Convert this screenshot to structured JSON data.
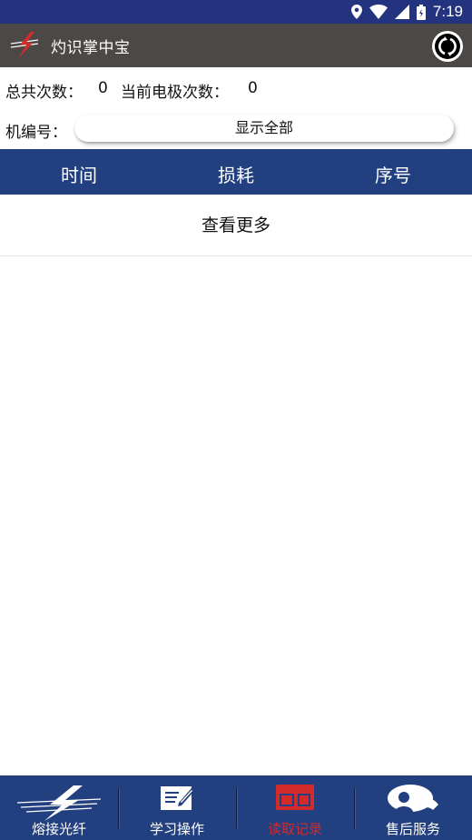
{
  "status_bar": {
    "time": "7:19",
    "icons": [
      "location-icon",
      "wifi-icon",
      "signal-icon",
      "battery-icon"
    ]
  },
  "app_bar": {
    "title": "灼识掌中宝",
    "logo": "lightning-logo",
    "action": "refresh-icon"
  },
  "stats": {
    "total_label": "总共次数：",
    "total_value": "0",
    "current_label": "当前电极次数：",
    "current_value": "0"
  },
  "machine": {
    "label": "机编号：",
    "selected": "显示全部"
  },
  "table": {
    "columns": [
      "时间",
      "损耗",
      "序号"
    ],
    "rows": []
  },
  "more_label": "查看更多",
  "bottom_nav": {
    "items": [
      {
        "label": "熔接光纤",
        "icon": "lightning-icon",
        "active": false
      },
      {
        "label": "学习操作",
        "icon": "notebook-pencil-icon",
        "active": false
      },
      {
        "label": "读取记录",
        "icon": "devices-icon",
        "active": true
      },
      {
        "label": "售后服务",
        "icon": "service-icon",
        "active": false
      }
    ]
  },
  "colors": {
    "status_bar": "#24337f",
    "app_bar": "#4b4846",
    "header": "#223f80",
    "active": "#d42a2a"
  }
}
